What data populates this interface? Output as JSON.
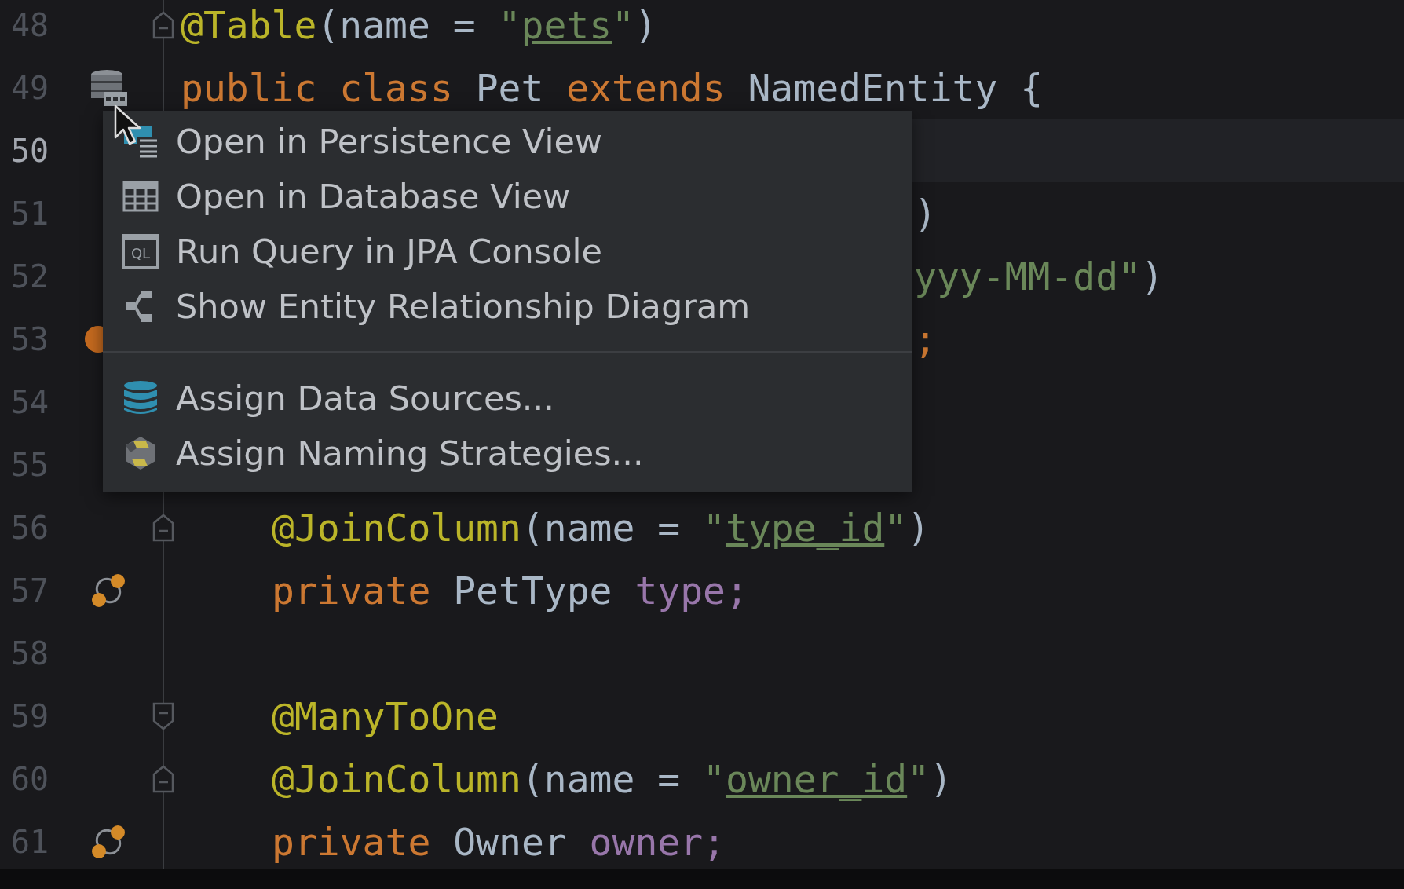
{
  "editor": {
    "lines": [
      {
        "number": "48",
        "fold": {
          "kind": "start"
        },
        "tokens": [
          {
            "kind": "annotation",
            "text": "@Table"
          },
          {
            "kind": "plain",
            "text": "(name = "
          },
          {
            "kind": "string",
            "text": "\""
          },
          {
            "kind": "link",
            "text": "pets"
          },
          {
            "kind": "string",
            "text": "\""
          },
          {
            "kind": "plain",
            "text": ")"
          }
        ]
      },
      {
        "number": "49",
        "gutter": {
          "kind": "table"
        },
        "tokens": [
          {
            "kind": "keyword",
            "text": "public class "
          },
          {
            "kind": "plain",
            "text": "Pet "
          },
          {
            "kind": "keyword",
            "text": "extends "
          },
          {
            "kind": "plain",
            "text": "NamedEntity {"
          }
        ]
      },
      {
        "number": "50",
        "current": true
      },
      {
        "number": "51",
        "covered": true,
        "tokens": [
          {
            "kind": "plain",
            "text": ")"
          }
        ]
      },
      {
        "number": "52",
        "covered": true,
        "tokens": [
          {
            "kind": "string",
            "text": "yyy-MM-dd\""
          },
          {
            "kind": "plain",
            "text": ")"
          }
        ]
      },
      {
        "number": "53",
        "gutter": {
          "kind": "badge"
        },
        "covered": true,
        "tokens": [
          {
            "kind": "keyword",
            "text": ";"
          }
        ]
      },
      {
        "number": "54",
        "covered": true
      },
      {
        "number": "55",
        "covered": true
      },
      {
        "number": "56",
        "fold": {
          "kind": "start"
        },
        "indented": true,
        "tokens": [
          {
            "kind": "annotation",
            "text": "@JoinColumn"
          },
          {
            "kind": "plain",
            "text": "(name = "
          },
          {
            "kind": "string",
            "text": "\""
          },
          {
            "kind": "link",
            "text": "type_id"
          },
          {
            "kind": "string",
            "text": "\""
          },
          {
            "kind": "plain",
            "text": ")"
          }
        ]
      },
      {
        "number": "57",
        "gutter": {
          "kind": "relation"
        },
        "indented": true,
        "tokens": [
          {
            "kind": "keyword",
            "text": "private "
          },
          {
            "kind": "plain",
            "text": "PetType "
          },
          {
            "kind": "field",
            "text": "type;"
          }
        ]
      },
      {
        "number": "58"
      },
      {
        "number": "59",
        "fold": {
          "kind": "end"
        },
        "indented": true,
        "tokens": [
          {
            "kind": "annotation",
            "text": "@ManyToOne"
          }
        ]
      },
      {
        "number": "60",
        "fold": {
          "kind": "start"
        },
        "indented": true,
        "tokens": [
          {
            "kind": "annotation",
            "text": "@JoinColumn"
          },
          {
            "kind": "plain",
            "text": "(name = "
          },
          {
            "kind": "string",
            "text": "\""
          },
          {
            "kind": "link",
            "text": "owner_id"
          },
          {
            "kind": "string",
            "text": "\""
          },
          {
            "kind": "plain",
            "text": ")"
          }
        ]
      },
      {
        "number": "61",
        "gutter": {
          "kind": "relation"
        },
        "indented": true,
        "tokens": [
          {
            "kind": "keyword",
            "text": "private "
          },
          {
            "kind": "plain",
            "text": "Owner "
          },
          {
            "kind": "field",
            "text": "owner;"
          }
        ]
      }
    ]
  },
  "context_menu": {
    "groups": [
      [
        {
          "label": "Open in Persistence View",
          "kind": "persistence",
          "selected": false
        },
        {
          "label": "Open in Database View",
          "kind": "grid",
          "selected": false
        },
        {
          "label": "Run Query in JPA Console",
          "kind": "console",
          "icon_text": "QL",
          "selected": false
        },
        {
          "label": "Show Entity Relationship Diagram",
          "kind": "diagram",
          "selected": false
        }
      ],
      [
        {
          "label": "Assign Data Sources...",
          "kind": "database",
          "selected": false
        },
        {
          "label": "Assign Naming Strategies...",
          "kind": "cube",
          "selected": false
        }
      ]
    ]
  }
}
